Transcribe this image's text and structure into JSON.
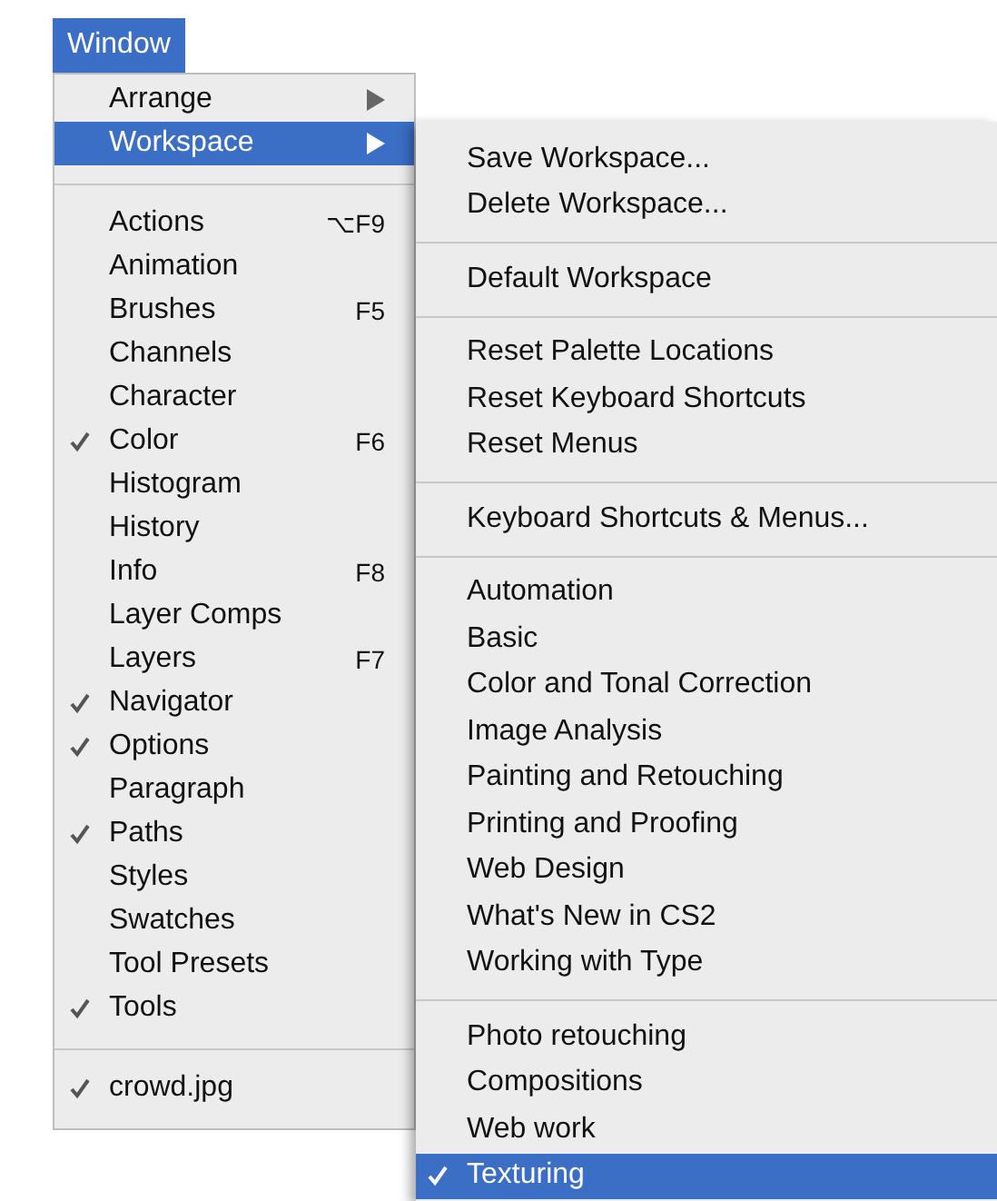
{
  "menu_title": "Window",
  "menu": {
    "groups": [
      {
        "items": [
          {
            "label": "Arrange",
            "submenu": true,
            "checked": false,
            "selected": false
          },
          {
            "label": "Workspace",
            "submenu": true,
            "checked": false,
            "selected": true
          }
        ]
      },
      {
        "items": [
          {
            "label": "Actions",
            "shortcut": "⌥F9",
            "checked": false,
            "selected": false
          },
          {
            "label": "Animation",
            "checked": false,
            "selected": false
          },
          {
            "label": "Brushes",
            "shortcut": "F5",
            "checked": false,
            "selected": false
          },
          {
            "label": "Channels",
            "checked": false,
            "selected": false
          },
          {
            "label": "Character",
            "checked": false,
            "selected": false
          },
          {
            "label": "Color",
            "shortcut": "F6",
            "checked": true,
            "selected": false
          },
          {
            "label": "Histogram",
            "checked": false,
            "selected": false
          },
          {
            "label": "History",
            "checked": false,
            "selected": false
          },
          {
            "label": "Info",
            "shortcut": "F8",
            "checked": false,
            "selected": false
          },
          {
            "label": "Layer Comps",
            "checked": false,
            "selected": false
          },
          {
            "label": "Layers",
            "shortcut": "F7",
            "checked": false,
            "selected": false
          },
          {
            "label": "Navigator",
            "checked": true,
            "selected": false
          },
          {
            "label": "Options",
            "checked": true,
            "selected": false
          },
          {
            "label": "Paragraph",
            "checked": false,
            "selected": false
          },
          {
            "label": "Paths",
            "checked": true,
            "selected": false
          },
          {
            "label": "Styles",
            "checked": false,
            "selected": false
          },
          {
            "label": "Swatches",
            "checked": false,
            "selected": false
          },
          {
            "label": "Tool Presets",
            "checked": false,
            "selected": false
          },
          {
            "label": "Tools",
            "checked": true,
            "selected": false
          }
        ]
      },
      {
        "items": [
          {
            "label": "crowd.jpg",
            "checked": true,
            "selected": false
          }
        ]
      }
    ]
  },
  "submenu": {
    "groups": [
      {
        "items": [
          {
            "label": "Save Workspace...",
            "checked": false,
            "selected": false
          },
          {
            "label": "Delete Workspace...",
            "checked": false,
            "selected": false
          }
        ]
      },
      {
        "items": [
          {
            "label": "Default Workspace",
            "checked": false,
            "selected": false
          }
        ]
      },
      {
        "items": [
          {
            "label": "Reset Palette Locations",
            "checked": false,
            "selected": false
          },
          {
            "label": "Reset Keyboard Shortcuts",
            "checked": false,
            "selected": false
          },
          {
            "label": "Reset Menus",
            "checked": false,
            "selected": false
          }
        ]
      },
      {
        "items": [
          {
            "label": "Keyboard Shortcuts & Menus...",
            "checked": false,
            "selected": false
          }
        ]
      },
      {
        "items": [
          {
            "label": "Automation",
            "checked": false,
            "selected": false
          },
          {
            "label": "Basic",
            "checked": false,
            "selected": false
          },
          {
            "label": "Color and Tonal Correction",
            "checked": false,
            "selected": false
          },
          {
            "label": "Image Analysis",
            "checked": false,
            "selected": false
          },
          {
            "label": "Painting and Retouching",
            "checked": false,
            "selected": false
          },
          {
            "label": "Printing and Proofing",
            "checked": false,
            "selected": false
          },
          {
            "label": "Web Design",
            "checked": false,
            "selected": false
          },
          {
            "label": "What's New in CS2",
            "checked": false,
            "selected": false
          },
          {
            "label": "Working with Type",
            "checked": false,
            "selected": false
          }
        ]
      },
      {
        "items": [
          {
            "label": "Photo retouching",
            "checked": false,
            "selected": false
          },
          {
            "label": "Compositions",
            "checked": false,
            "selected": false
          },
          {
            "label": "Web work",
            "checked": false,
            "selected": false
          },
          {
            "label": "Texturing",
            "checked": true,
            "selected": true
          }
        ]
      }
    ]
  }
}
